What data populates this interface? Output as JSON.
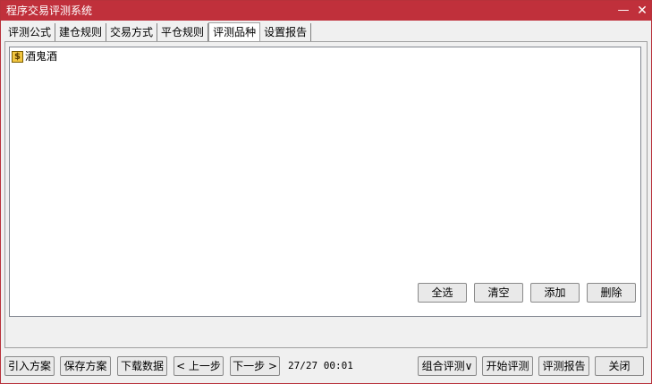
{
  "window": {
    "title": "程序交易评测系统",
    "minimize_glyph": "—",
    "close_glyph": "✕"
  },
  "tabs": [
    {
      "label": "评测公式"
    },
    {
      "label": "建仓规则"
    },
    {
      "label": "交易方式"
    },
    {
      "label": "平仓规则"
    },
    {
      "label": "评测品种",
      "active": true
    },
    {
      "label": "设置报告"
    }
  ],
  "symbol_list": {
    "items": [
      {
        "icon": "dollar-stock-icon",
        "icon_glyph": "$",
        "label": "酒鬼酒"
      }
    ]
  },
  "list_actions": {
    "select_all": "全选",
    "clear": "清空",
    "add": "添加",
    "delete": "删除"
  },
  "footer": {
    "import_plan": "引入方案",
    "save_plan": "保存方案",
    "download_data": "下载数据",
    "prev_step": "< 上一步",
    "next_step": "下一步 >",
    "status": "27/27 00:01",
    "combo_eval": "组合评测∨",
    "start_eval": "开始评测",
    "eval_report": "评测报告",
    "close": "关闭"
  },
  "colors": {
    "titlebar": "#c0303b",
    "window_bg": "#f0f0f0",
    "list_bg": "#ffffff"
  }
}
